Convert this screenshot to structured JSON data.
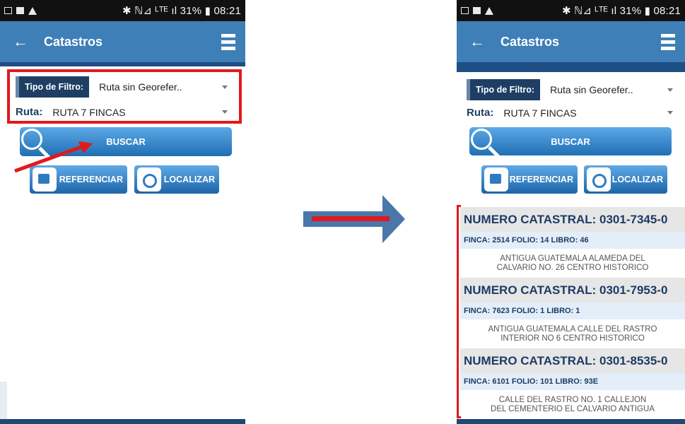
{
  "status_bar": {
    "left_icons": [
      "screenshot-icon",
      "image-icon",
      "alert-icon"
    ],
    "right_text": "✱ ℕ⊿ ᴸᵀᴱ ıl 31% ▮ 08:21"
  },
  "app_bar": {
    "title": "Catastros",
    "back_icon": "←"
  },
  "filter": {
    "label": "Tipo de Filtro:",
    "value": "Ruta sin Georefer.."
  },
  "ruta": {
    "label": "Ruta:",
    "value": "RUTA 7 FINCAS"
  },
  "buttons": {
    "buscar": "BUSCAR",
    "referenciar": "REFERENCIAR",
    "localizar": "LOCALIZAR"
  },
  "results": [
    {
      "numero": "NUMERO CATASTRAL: 0301-7345-0",
      "detalle": "FINCA: 2514 FOLIO: 14 LIBRO: 46",
      "direccion_1": "ANTIGUA GUATEMALA ALAMEDA DEL",
      "direccion_2": "CALVARIO NO. 26 CENTRO HISTORICO"
    },
    {
      "numero": "NUMERO CATASTRAL: 0301-7953-0",
      "detalle": "FINCA: 7623 FOLIO: 1 LIBRO: 1",
      "direccion_1": "ANTIGUA GUATEMALA CALLE DEL RASTRO",
      "direccion_2": "INTERIOR NO 6 CENTRO HISTORICO"
    },
    {
      "numero": "NUMERO CATASTRAL: 0301-8535-0",
      "detalle": "FINCA: 6101 FOLIO: 101 LIBRO: 93E",
      "direccion_1": "CALLE DEL RASTRO NO. 1 CALLEJON",
      "direccion_2": "DEL CEMENTERIO EL CALVARIO ANTIGUA"
    }
  ],
  "colors": {
    "app_bar": "#3f7fb7",
    "navy": "#1f3e64",
    "highlight": "#e2191c",
    "button": "#2f7bc2"
  },
  "icons": [
    "back-arrow-icon",
    "hamburger-menu-icon",
    "dropdown-caret-icon",
    "magnifier-icon",
    "referenciar-icon",
    "localizar-icon",
    "right-arrow-icon"
  ]
}
